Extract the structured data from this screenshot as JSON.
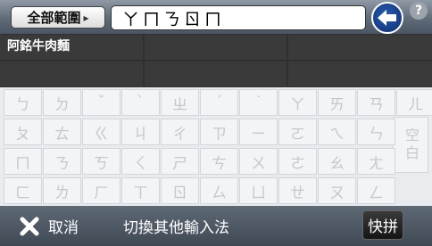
{
  "top": {
    "scope_label": "全部範圍",
    "scope_arrow": "▸",
    "search_value": "ㄚㄇㄋㄖㄇ",
    "help_label": "?"
  },
  "results": [
    [
      "阿銘牛肉麵",
      "",
      ""
    ],
    [
      "",
      "",
      ""
    ]
  ],
  "keyboard": {
    "rows": [
      [
        "ㄅ",
        "ㄉ",
        "ˇ",
        "ˋ",
        "ㄓ",
        "ˊ",
        "˙",
        "ㄚ",
        "ㄞ",
        "ㄢ",
        "ㄦ"
      ],
      [
        "ㄆ",
        "ㄊ",
        "ㄍ",
        "ㄐ",
        "ㄔ",
        "ㄗ",
        "ㄧ",
        "ㄛ",
        "ㄟ",
        "ㄣ"
      ],
      [
        "ㄇ",
        "ㄋ",
        "ㄎ",
        "ㄑ",
        "ㄕ",
        "ㄘ",
        "ㄨ",
        "ㄜ",
        "ㄠ",
        "ㄤ"
      ],
      [
        "ㄈ",
        "ㄌ",
        "ㄏ",
        "ㄒ",
        "ㄖ",
        "ㄙ",
        "ㄩ",
        "ㄝ",
        "ㄡ",
        "ㄥ"
      ]
    ],
    "space_label": "空白"
  },
  "bottom": {
    "cancel_label": "取消",
    "switch_label": "切換其他輸入法",
    "mode_label": "快拼"
  },
  "colors": {
    "accent_blue": "#0b2d72",
    "bar_gray": "#4a5663"
  }
}
